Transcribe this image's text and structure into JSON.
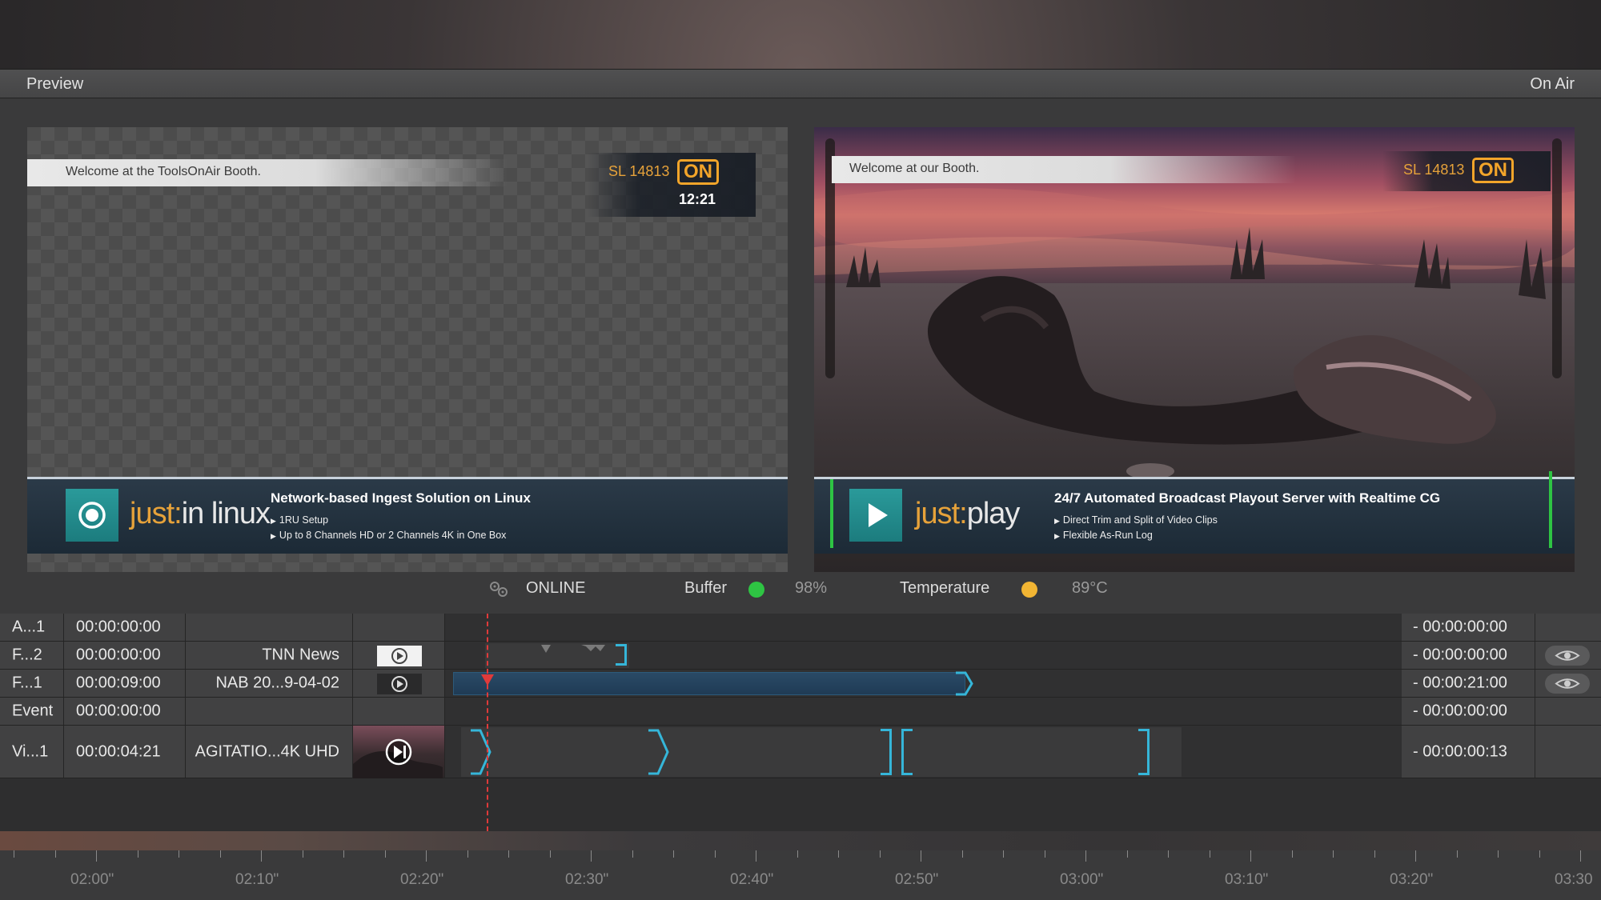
{
  "window": {
    "left_title": "Preview",
    "right_title": "On Air"
  },
  "preview": {
    "welcome": "Welcome at the ToolsOnAir Booth.",
    "sl": "SL 14813",
    "badge": "ON",
    "clock": "12:21",
    "brand_just": "just:",
    "brand_product": "in linux",
    "headline": "Network-based Ingest Solution on Linux",
    "bullets": [
      "1RU Setup",
      "Up to 8 Channels HD or 2 Channels 4K in One Box"
    ]
  },
  "onair": {
    "welcome": "Welcome at our Booth.",
    "sl": "SL 14813",
    "badge": "ON",
    "brand_just": "just:",
    "brand_product": "play",
    "headline": "24/7 Automated Broadcast Playout Server with Realtime CG",
    "bullets": [
      "Direct Trim and Split of Video Clips",
      "Flexible As-Run Log"
    ]
  },
  "status": {
    "online": "ONLINE",
    "buffer_label": "Buffer",
    "buffer_value": "98%",
    "buffer_color": "#2ec443",
    "temp_label": "Temperature",
    "temp_value": "89°C",
    "temp_color": "#f2b533"
  },
  "tracks": [
    {
      "name": "A...1",
      "time": "00:00:00:00",
      "title": "",
      "remaining": "- 00:00:00:00",
      "eye": false
    },
    {
      "name": "F...2",
      "time": "00:00:00:00",
      "title": "TNN News",
      "remaining": "- 00:00:00:00",
      "eye": true
    },
    {
      "name": "F...1",
      "time": "00:00:09:00",
      "title": "NAB 20...9-04-02",
      "remaining": "- 00:00:21:00",
      "eye": true
    },
    {
      "name": "Event",
      "time": "00:00:00:00",
      "title": "",
      "remaining": "- 00:00:00:00",
      "eye": false
    },
    {
      "name": "Vi...1",
      "time": "00:00:04:21",
      "title": "AGITATIO...4K UHD",
      "remaining": "- 00:00:00:13",
      "eye": false
    }
  ],
  "ruler": {
    "labels": [
      "02:00\"",
      "02:10\"",
      "02:20\"",
      "02:30\"",
      "02:40\"",
      "02:50\"",
      "03:00\"",
      "03:10\"",
      "03:20\"",
      "03:30"
    ]
  },
  "colors": {
    "accent_orange": "#f3a52a",
    "clip_cyan": "#35b6d9",
    "playhead_red": "#e03a3a"
  }
}
